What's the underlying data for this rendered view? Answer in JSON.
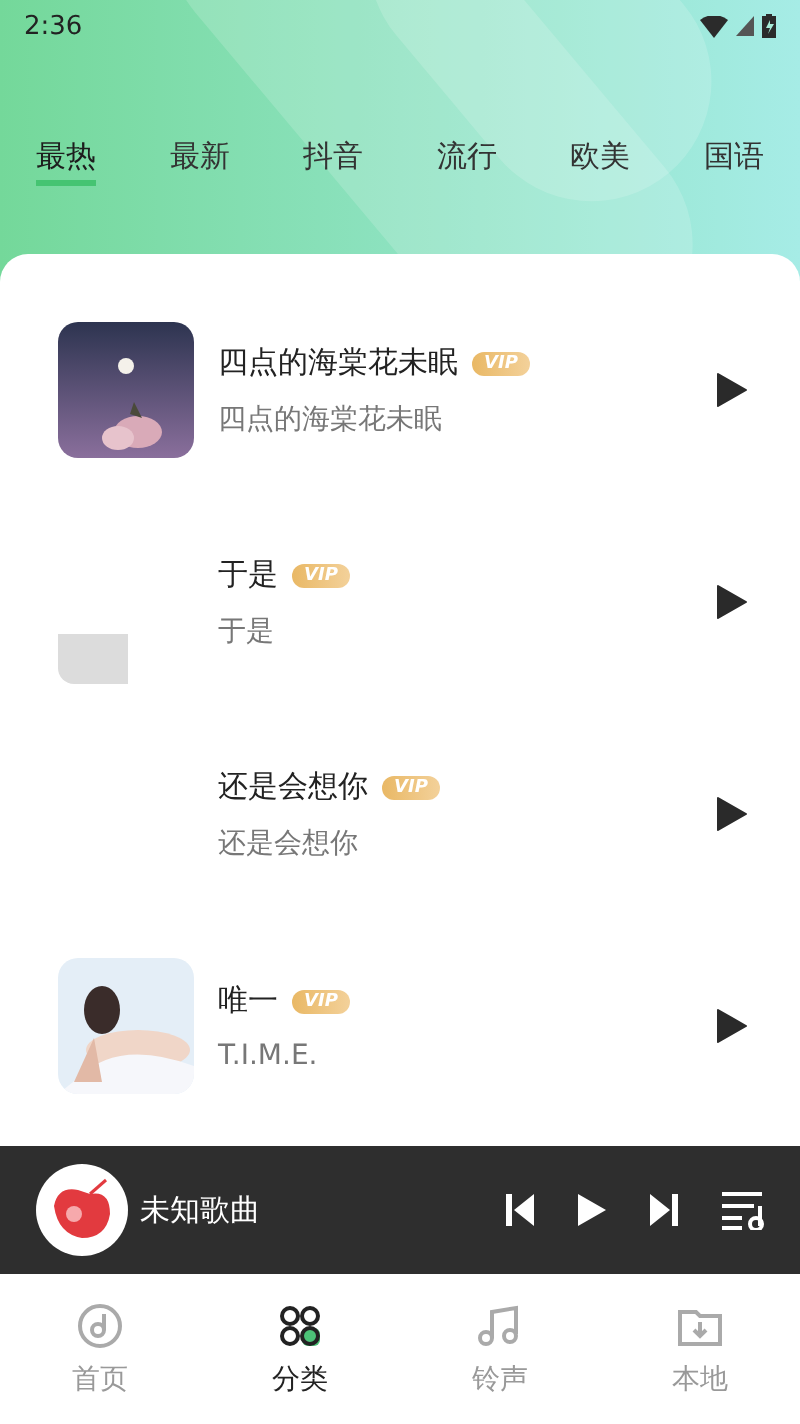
{
  "status_bar": {
    "time": "2:36"
  },
  "tabs": [
    {
      "label": "最热",
      "selected": true
    },
    {
      "label": "最新",
      "selected": false
    },
    {
      "label": "抖音",
      "selected": false
    },
    {
      "label": "流行",
      "selected": false
    },
    {
      "label": "欧美",
      "selected": false
    },
    {
      "label": "国语",
      "selected": false
    }
  ],
  "songs": [
    {
      "title": "四点的海棠花未眠",
      "vip": "VIP",
      "artist": "四点的海棠花未眠",
      "kind": "picture"
    },
    {
      "title": "于是",
      "vip": "VIP",
      "artist": "于是",
      "kind": "loading"
    },
    {
      "title": "还是会想你",
      "vip": "VIP",
      "artist": "还是会想你",
      "kind": "blank"
    },
    {
      "title": "唯一",
      "vip": "VIP",
      "artist": "T.I.M.E.",
      "kind": "picture"
    }
  ],
  "player": {
    "title": "未知歌曲"
  },
  "nav": [
    {
      "label": "首页",
      "selected": false
    },
    {
      "label": "分类",
      "selected": true
    },
    {
      "label": "铃声",
      "selected": false
    },
    {
      "label": "本地",
      "selected": false
    }
  ]
}
